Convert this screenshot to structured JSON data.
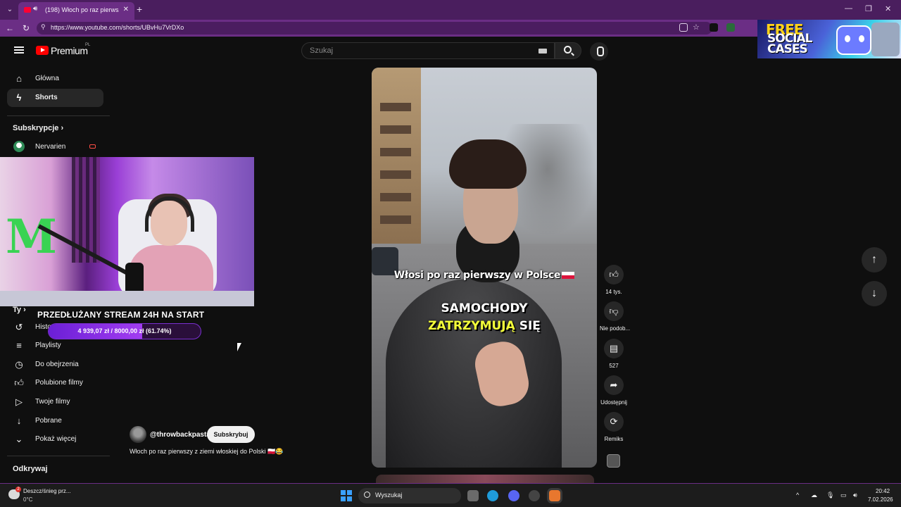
{
  "browser": {
    "tab_title": "(198) Włoch po raz pierwszy z",
    "url": "https://www.youtube.com/shorts/UBvHu7VrDXo"
  },
  "ad": {
    "line1": "FREE",
    "line2": "SOCIAL",
    "line3": "CASES"
  },
  "header": {
    "brand": "Premium",
    "region": "PL",
    "search_placeholder": "Szukaj"
  },
  "sidebar": {
    "items": [
      {
        "label": "Główna",
        "icon": "home-icon"
      },
      {
        "label": "Shorts",
        "icon": "shorts-icon"
      }
    ],
    "subscriptions_heading": "Subskrypcje",
    "subscription_channel": "Nervarien",
    "you_heading": "Ty",
    "you_items": [
      {
        "label": "Historia",
        "icon": "history-icon"
      },
      {
        "label": "Playlisty",
        "icon": "playlist-icon"
      },
      {
        "label": "Do obejrzenia",
        "icon": "watch-later-icon"
      },
      {
        "label": "Polubione filmy",
        "icon": "thumbs-up-icon"
      },
      {
        "label": "Twoje filmy",
        "icon": "your-videos-icon"
      },
      {
        "label": "Pobrane",
        "icon": "download-icon"
      },
      {
        "label": "Pokaż więcej",
        "icon": "chevron-down-icon"
      }
    ],
    "explore_heading": "Odkrywaj"
  },
  "stream_overlay": {
    "goal_title": "PRZEDŁUŻANY STREAM 24H NA START",
    "goal_text": "4 939,07 zł  /  8000,00 zł  (61.74%)",
    "goal_fraction": 0.6174
  },
  "short": {
    "caption_top": "Włosi po raz pierwszy w Polsce",
    "caption_mid": "SAMOCHODY",
    "caption_bottom_yellow": "ZATRZYMUJĄ",
    "caption_bottom_white": "SIĘ",
    "channel": "@throwbackpasta",
    "subscribe": "Subskrybuj",
    "description": "Włoch po raz pierwszy z ziemi włoskiej do Polski 🇵🇱😂"
  },
  "actions": {
    "like_count": "14 tys.",
    "dislike_label": "Nie podob...",
    "comments_count": "527",
    "share_label": "Udostępnij",
    "remix_label": "Remiks"
  },
  "taskbar": {
    "weather_line1": "Deszcz/śnieg prz...",
    "weather_line2": "0°C",
    "weather_badge": "2",
    "search_label": "Wyszukaj",
    "time": "20:42",
    "date": "7.02.2026"
  },
  "colors": {
    "chrome_accent": "#6b2e85",
    "youtube_red": "#ff0000",
    "goal_purple": "#a23df0"
  }
}
